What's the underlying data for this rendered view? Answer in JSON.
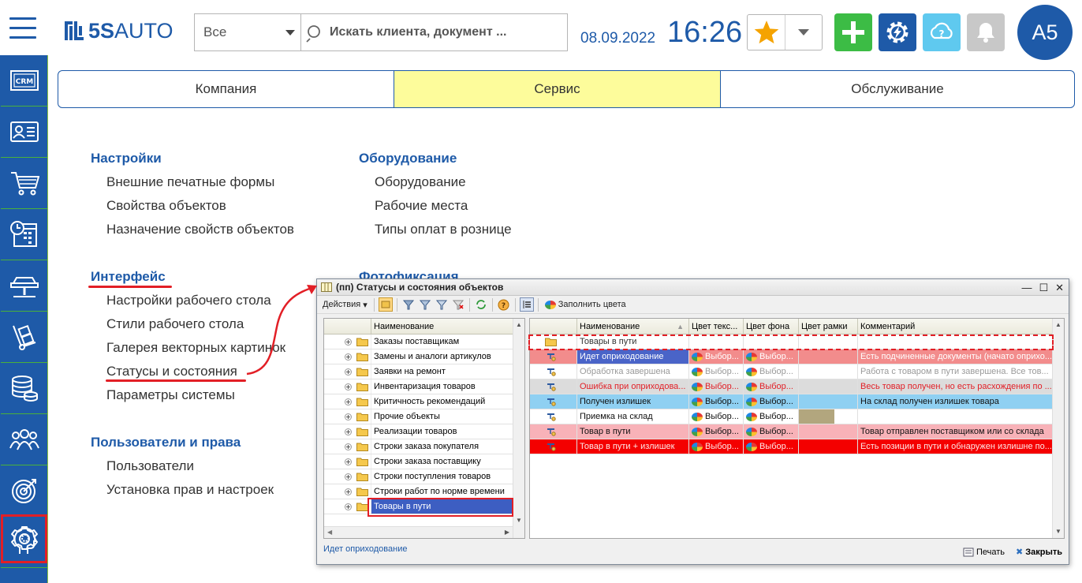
{
  "header": {
    "logo_text_bold": "5S",
    "logo_text": "AUTO",
    "scope_value": "Все",
    "search_placeholder": "Искать клиента, документ ...",
    "date": "08.09.2022",
    "time": "16:26",
    "avatar_initials": "А5"
  },
  "sidebar": {
    "items": [
      "crm",
      "contacts",
      "cart",
      "calendar",
      "car-lift",
      "delivery",
      "coins",
      "team",
      "target",
      "support",
      "settings"
    ],
    "crm_label": "CRM"
  },
  "tabs": [
    "Компания",
    "Сервис",
    "Обслуживание"
  ],
  "menu": {
    "settings": {
      "title": "Настройки",
      "items": [
        "Внешние печатные формы",
        "Свойства объектов",
        "Назначение свойств объектов"
      ]
    },
    "equipment": {
      "title": "Оборудование",
      "items": [
        "Оборудование",
        "Рабочие места",
        "Типы оплат в рознице"
      ]
    },
    "photo": {
      "title": "Фотофиксация"
    },
    "interface": {
      "title": "Интерфейс",
      "items": [
        "Настройки рабочего стола",
        "Стили рабочего стола",
        "Галерея векторных картинок",
        "Статусы и состояния",
        "Параметры системы"
      ]
    },
    "users": {
      "title": "Пользователи и права",
      "items": [
        "Пользователи",
        "Установка прав и настроек"
      ]
    }
  },
  "dialog": {
    "title": "(пп) Статусы и состояния объектов",
    "actions_label": "Действия",
    "fill_colors_label": "Заполнить цвета",
    "left_header": "Наименование",
    "left_rows": [
      "Заказы поставщикам",
      "Замены и аналоги артикулов",
      "Заявки на ремонт",
      "Инвентаризация товаров",
      "Критичность рекомендаций",
      "Прочие объекты",
      "Реализации товаров",
      "Строки заказа покупателя",
      "Строки заказа поставщику",
      "Строки поступления товаров",
      "Строки работ по норме времени",
      "Товары в пути"
    ],
    "right_headers": [
      "Наименование",
      "Цвет текс...",
      "Цвет фона",
      "Цвет рамки",
      "Комментарий"
    ],
    "choose_label": "Выбор...",
    "right_rows": [
      {
        "name": "Товары в пути",
        "text_color": "",
        "bg_color": "",
        "frame": "",
        "comment": "",
        "fg": "#333333",
        "bg": "#ffffff"
      },
      {
        "name": "Идет оприходование",
        "text_color": "Выбор...",
        "bg_color": "Выбор...",
        "frame": "",
        "comment": "Есть подчиненные документы (начато оприхо...",
        "fg": "#ffffff",
        "bg": "#f28c8c",
        "namebg": "#4a64c8"
      },
      {
        "name": "Обработка завершена",
        "text_color": "Выбор...",
        "bg_color": "Выбор...",
        "frame": "",
        "comment": "Работа с товаром в пути завершена. Все тов...",
        "fg": "#9a9a9a",
        "bg": "#ffffff"
      },
      {
        "name": "Ошибка при оприходова...",
        "text_color": "Выбор...",
        "bg_color": "Выбор...",
        "frame": "",
        "comment": "Весь товар получен, но есть расхождения по ...",
        "fg": "#e21f26",
        "bg": "#dcdcdc"
      },
      {
        "name": "Получен излишек",
        "text_color": "Выбор...",
        "bg_color": "Выбор...",
        "frame": "",
        "comment": "На склад получен излишек товара",
        "fg": "#111111",
        "bg": "#8fd0f2"
      },
      {
        "name": "Приемка на склад",
        "text_color": "Выбор...",
        "bg_color": "Выбор...",
        "frame": "",
        "comment": "",
        "fg": "#111111",
        "bg": "#ffffff",
        "framebg": "#b2a67e"
      },
      {
        "name": "Товар в пути",
        "text_color": "Выбор...",
        "bg_color": "Выбор...",
        "frame": "",
        "comment": "Товар отправлен поставщиком или со склада",
        "fg": "#111111",
        "bg": "#f8b2b8"
      },
      {
        "name": "Товар в пути + излишек",
        "text_color": "Выбор...",
        "bg_color": "Выбор...",
        "frame": "",
        "comment": "Есть позиции в пути и обнаружен излишне по...",
        "fg": "#fde8e8",
        "bg": "#f40000"
      }
    ],
    "status_text": "Идет оприходование",
    "print_label": "Печать",
    "close_label": "Закрыть"
  },
  "colors": {
    "brand": "#1e5aa8",
    "accent_red": "#e21f26",
    "tab_active": "#fdfc9b"
  }
}
